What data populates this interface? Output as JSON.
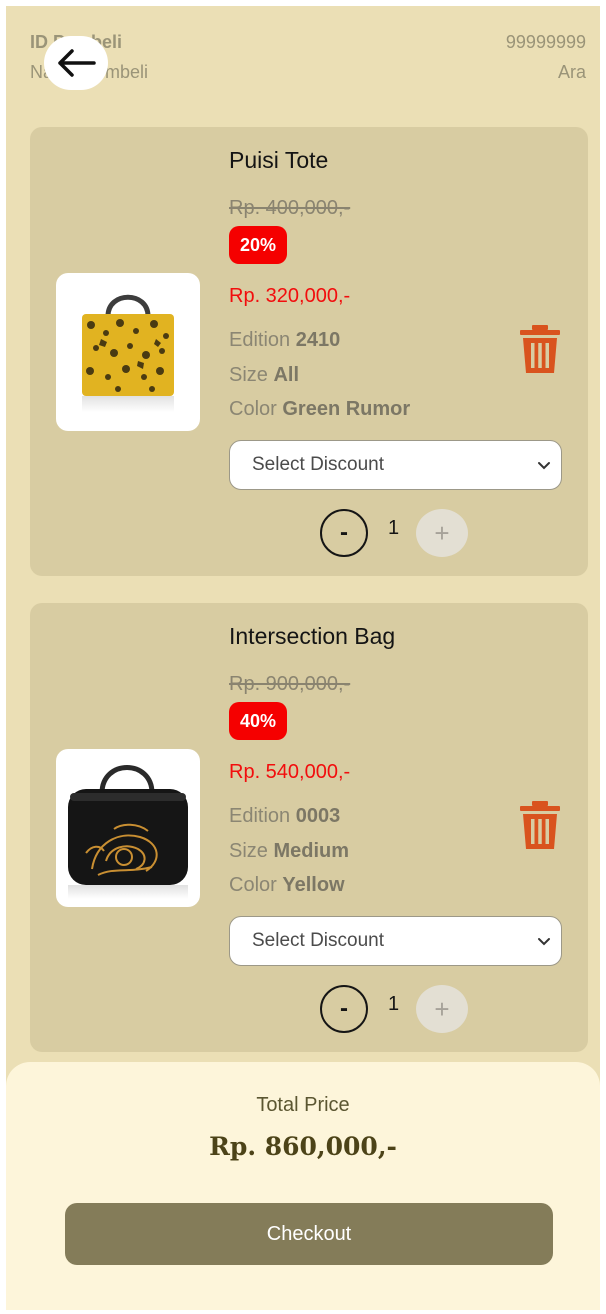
{
  "buyer": {
    "id_label": "ID Pembeli",
    "name_label": "Nama Pembeli",
    "id_value": "99999999",
    "name_value": "Ara"
  },
  "icons": {
    "back": "arrow-left-icon",
    "delete": "trash-icon",
    "select": "chevron-down-icon"
  },
  "colors": {
    "background": "#ebdfb5",
    "card": "#d8cca2",
    "discount_badge": "#f50000",
    "final_price": "#f20d0d",
    "delete_icon": "#d9531e",
    "checkout_button": "#847c59",
    "summary_panel": "#fdf5da"
  },
  "items": [
    {
      "name": "Puisi Tote",
      "original_price": "Rp. 400,000,-",
      "discount_badge": "20%",
      "final_price": "Rp. 320,000,-",
      "edition_label": "Edition",
      "edition_value": "2410",
      "size_label": "Size",
      "size_value": "All",
      "color_label": "Color",
      "color_value": "Green Rumor",
      "discount_select": "Select Discount",
      "qty_minus": "-",
      "quantity": "1",
      "qty_plus": "+"
    },
    {
      "name": "Intersection Bag",
      "original_price": "Rp. 900,000,-",
      "discount_badge": "40%",
      "final_price": "Rp. 540,000,-",
      "edition_label": "Edition",
      "edition_value": "0003",
      "size_label": "Size",
      "size_value": "Medium",
      "color_label": "Color",
      "color_value": "Yellow",
      "discount_select": "Select Discount",
      "qty_minus": "-",
      "quantity": "1",
      "qty_plus": "+"
    }
  ],
  "summary": {
    "total_label": "Total Price",
    "total_value": "Rp. 860,000,-",
    "checkout_label": "Checkout"
  }
}
